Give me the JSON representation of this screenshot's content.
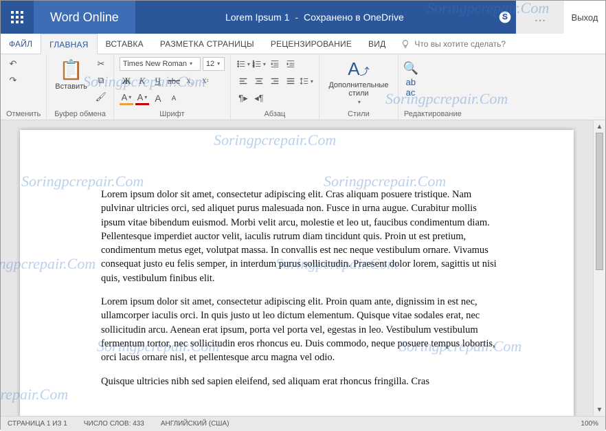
{
  "header": {
    "app_name": "Word Online",
    "doc_title": "Lorem Ipsum 1",
    "save_status": "Сохранено в OneDrive",
    "user_menu_dots": "...",
    "signout": "Выход"
  },
  "tabs": {
    "file": "ФАЙЛ",
    "home": "ГЛАВНАЯ",
    "insert": "ВСТАВКА",
    "layout": "РАЗМЕТКА СТРАНИЦЫ",
    "review": "РЕЦЕНЗИРОВАНИЕ",
    "view": "ВИД",
    "tellme": "Что вы хотите сделать?"
  },
  "ribbon": {
    "undo_group": "Отменить",
    "clipboard_group": "Буфер обмена",
    "paste_label": "Вставить",
    "font_group": "Шрифт",
    "font_name": "Times New Roman",
    "font_size": "12",
    "paragraph_group": "Абзац",
    "styles_group": "Стили",
    "styles_label": "Дополнительные стили",
    "editing_group": "Редактирование",
    "bold": "Ж",
    "italic": "К",
    "underline": "Ч",
    "strike": "abc",
    "sub": "X₂",
    "sup": "X²",
    "grow": "A",
    "shrink": "A",
    "highlight": "A",
    "fontcolor": "A"
  },
  "document": {
    "p1": "Lorem ipsum dolor sit amet, consectetur adipiscing elit. Cras aliquam posuere tristique. Nam pulvinar ultricies orci, sed aliquet purus malesuada non. Fusce in urna augue. Curabitur mollis ipsum vitae bibendum euismod. Morbi velit arcu, molestie et leo ut, faucibus condimentum diam. Pellentesque imperdiet auctor velit, iaculis rutrum diam tincidunt quis. Proin ut est pretium, condimentum metus eget, volutpat massa. In convallis est nec neque vestibulum ornare. Vivamus consequat justo eu felis semper, in interdum purus sollicitudin. Praesent dolor lorem, sagittis ut nisi quis, vestibulum finibus elit.",
    "p2": "Lorem ipsum dolor sit amet, consectetur adipiscing elit. Proin quam ante, dignissim in est nec, ullamcorper iaculis orci. In quis justo ut leo dictum elementum. Quisque vitae sodales erat, nec sollicitudin arcu. Aenean erat ipsum, porta vel porta vel, egestas in leo. Vestibulum vestibulum fermentum tortor, nec sollicitudin eros rhoncus eu. Duis commodo, neque posuere tempus lobortis, orci lacus ornare nisl, et pellentesque arcu magna vel odio.",
    "p3": "Quisque ultricies nibh sed sapien eleifend, sed aliquam erat rhoncus fringilla. Cras"
  },
  "status": {
    "page": "СТРАНИЦА 1 ИЗ 1",
    "words": "ЧИСЛО СЛОВ: 433",
    "lang": "АНГЛИЙСКИЙ (США)",
    "zoom": "100%"
  },
  "watermark": "Soringpcrepair.Com"
}
